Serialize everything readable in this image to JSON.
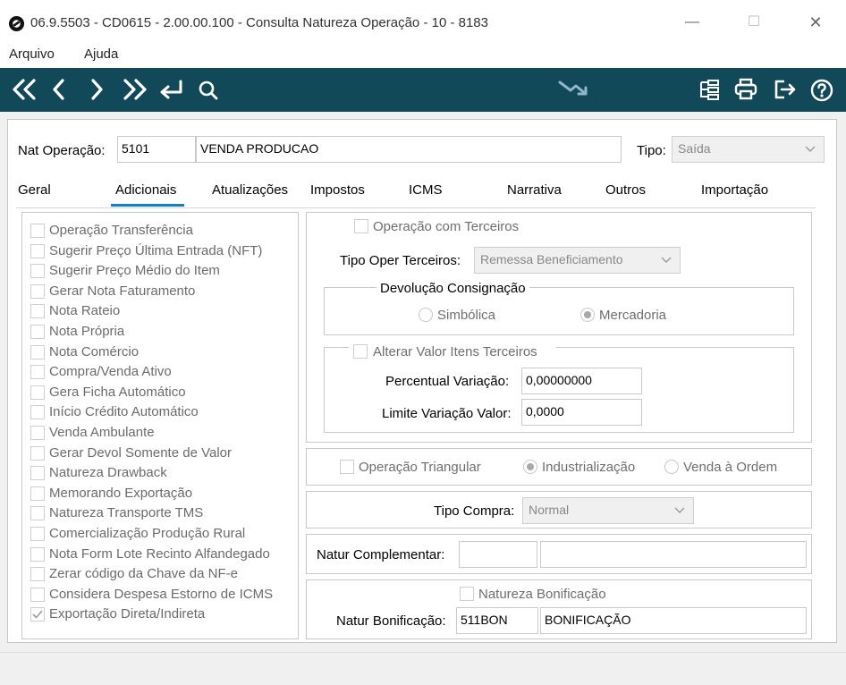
{
  "window": {
    "title": "06.9.5503 - CD0615 - 2.00.00.100 - Consulta Natureza Operação - 10 - 8183",
    "minimize": "—",
    "maximize": "☐",
    "close": "✕"
  },
  "menu": {
    "items": [
      "Arquivo",
      "Ajuda"
    ]
  },
  "colors": {
    "toolbar": "#124958",
    "tab_accent": "#0f81c6"
  },
  "toolbar": {
    "left_icons": [
      "first-icon",
      "previous-icon",
      "next-icon",
      "last-icon",
      "return-icon",
      "search-icon"
    ],
    "center_icons": [
      "trend-down-icon"
    ],
    "right_icons": [
      "tree-structure-icon",
      "print-icon",
      "exit-icon",
      "help-icon"
    ]
  },
  "header": {
    "nat_label": "Nat Operação:",
    "nat_code": "5101",
    "nat_desc": "VENDA PRODUCAO",
    "tipo_label": "Tipo:",
    "tipo_value": "Saída"
  },
  "tabs": [
    "Geral",
    "Adicionais",
    "Atualizações",
    "Impostos",
    "ICMS",
    "Narrativa",
    "Outros",
    "Importação"
  ],
  "checklist": [
    {
      "label": "Operação Transferência",
      "checked": false
    },
    {
      "label": "Sugerir Preço Última Entrada (NFT)",
      "checked": false
    },
    {
      "label": "Sugerir Preço Médio do Item",
      "checked": false
    },
    {
      "label": "Gerar Nota Faturamento",
      "checked": false
    },
    {
      "label": "Nota Rateio",
      "checked": false
    },
    {
      "label": "Nota Própria",
      "checked": false
    },
    {
      "label": "Nota Comércio",
      "checked": false
    },
    {
      "label": "Compra/Venda Ativo",
      "checked": false
    },
    {
      "label": "Gera Ficha Automático",
      "checked": false
    },
    {
      "label": "Início Crédito Automático",
      "checked": false
    },
    {
      "label": "Venda Ambulante",
      "checked": false
    },
    {
      "label": "Gerar Devol Somente de Valor",
      "checked": false
    },
    {
      "label": "Natureza Drawback",
      "checked": false
    },
    {
      "label": "Memorando Exportação",
      "checked": false
    },
    {
      "label": "Natureza Transporte TMS",
      "checked": false
    },
    {
      "label": "Comercialização Produção Rural",
      "checked": false
    },
    {
      "label": "Nota Form Lote Recinto Alfandegado",
      "checked": false
    },
    {
      "label": "Zerar código da Chave da NF-e",
      "checked": false
    },
    {
      "label": "Considera Despesa Estorno de ICMS",
      "checked": false
    },
    {
      "label": "Exportação Direta/Indireta",
      "checked": true
    }
  ],
  "terceiros": {
    "op_terceiros_label": "Operação com Terceiros",
    "tipo_oper_label": "Tipo Oper Terceiros:",
    "tipo_oper_value": "Remessa Beneficiamento",
    "devolucao_legend": "Devolução Consignação",
    "radio_simbolica": "Simbólica",
    "radio_mercadoria": "Mercadoria",
    "alterar_label": "Alterar Valor Itens Terceiros",
    "percentual_label": "Percentual Variação:",
    "percentual_value": "0,00000000",
    "limite_label": "Limite Variação Valor:",
    "limite_value": "0,0000"
  },
  "triangular": {
    "label": "Operação Triangular",
    "radio_industrializacao": "Industrialização",
    "radio_venda": "Venda à Ordem"
  },
  "tipo_compra": {
    "label": "Tipo Compra:",
    "value": "Normal"
  },
  "complementar": {
    "label": "Natur Complementar:",
    "code": "",
    "desc": ""
  },
  "bonificacao": {
    "checkbox_label": "Natureza Bonificação",
    "label": "Natur Bonificação:",
    "code": "511BON",
    "desc": "BONIFICAÇÃO"
  }
}
